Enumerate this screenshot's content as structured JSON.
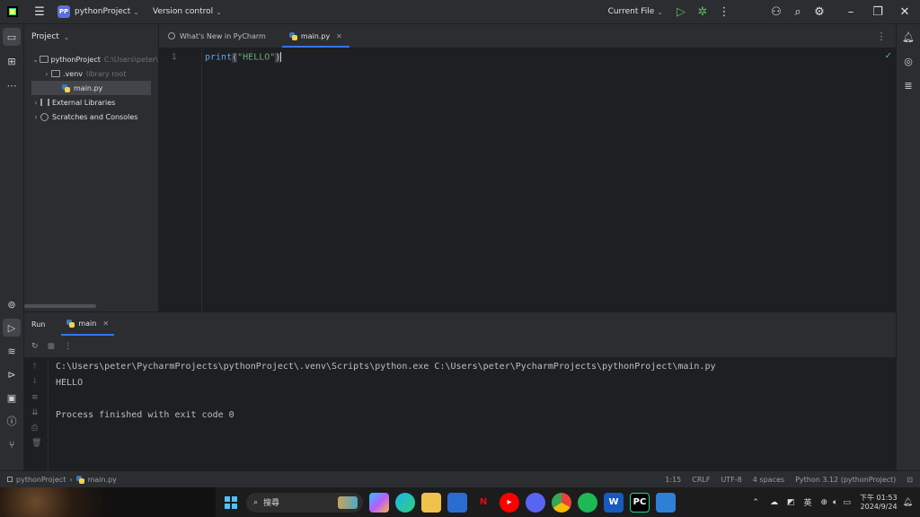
{
  "titlebar": {
    "project_badge": "PP",
    "project_name": "pythonProject",
    "vcs": "Version control",
    "run_config": "Current File"
  },
  "project_panel": {
    "title": "Project",
    "tree": [
      {
        "label": "pythonProject",
        "hint": "C:\\Users\\peter\\",
        "expanded": true,
        "indent": 0,
        "icon": "folder-icon"
      },
      {
        "label": ".venv",
        "hint": "library root",
        "expanded": false,
        "indent": 1,
        "icon": "folder-icon"
      },
      {
        "label": "main.py",
        "hint": "",
        "indent": 1,
        "icon": "python-file-icon",
        "selected": true
      },
      {
        "label": "External Libraries",
        "hint": "",
        "expanded": false,
        "indent": 0,
        "icon": "library-icon"
      },
      {
        "label": "Scratches and Consoles",
        "hint": "",
        "expanded": false,
        "indent": 0,
        "icon": "scratch-icon"
      }
    ]
  },
  "tabs": [
    {
      "label": "What's New in PyCharm",
      "active": false,
      "icon": "globe-icon"
    },
    {
      "label": "main.py",
      "active": true,
      "icon": "python-file-icon",
      "closable": true
    }
  ],
  "editor": {
    "line_number": "1",
    "code": {
      "fn": "print",
      "open": "(",
      "str": "\"HELLO\"",
      "close": ")"
    }
  },
  "run_panel": {
    "title": "Run",
    "tab_label": "main",
    "output": [
      "C:\\Users\\peter\\PycharmProjects\\pythonProject\\.venv\\Scripts\\python.exe C:\\Users\\peter\\PycharmProjects\\pythonProject\\main.py",
      "HELLO",
      "",
      "Process finished with exit code 0"
    ]
  },
  "statusbar": {
    "breadcrumb_project": "pythonProject",
    "breadcrumb_file": "main.py",
    "position": "1:15",
    "line_sep": "CRLF",
    "encoding": "UTF-8",
    "indent": "4 spaces",
    "interpreter": "Python 3.12 (pythonProject)"
  },
  "taskbar": {
    "search_label": "搜尋",
    "ime": "英",
    "clock_time": "下午 01:53",
    "clock_date": "2024/9/24"
  },
  "colors": {
    "accent": "#3574f0",
    "bg_dark": "#1e1f22",
    "panel": "#2b2d30",
    "string": "#6aab73",
    "function": "#56a8f5"
  }
}
